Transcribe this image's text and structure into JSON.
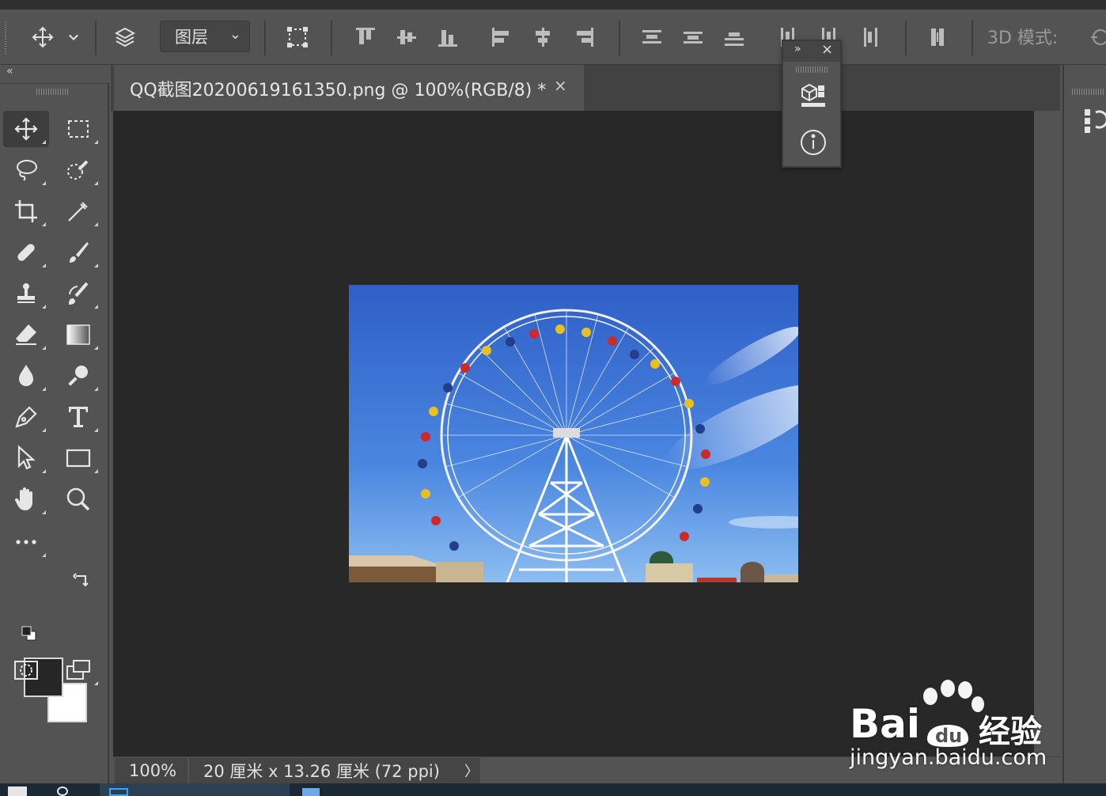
{
  "options_bar": {
    "layer_select_value": "图层",
    "mode_3d_label": "3D 模式:"
  },
  "document": {
    "tab_title": "QQ截图20200619161350.png @ 100%(RGB/8) *",
    "tab_close": "×"
  },
  "status_bar": {
    "zoom": "100%",
    "doc_size": "20 厘米 x 13.26 厘米 (72 ppi)",
    "arrow": "〉"
  },
  "mini_panel": {
    "expand_label": "»",
    "close_label": "×"
  },
  "toolbar": {
    "collapse_label": "«",
    "tools": [
      "move-tool",
      "rectangular-marquee-tool",
      "lasso-tool",
      "quick-selection-tool",
      "crop-tool",
      "eyedropper-tool",
      "spot-healing-tool",
      "brush-tool",
      "clone-stamp-tool",
      "history-brush-tool",
      "eraser-tool",
      "gradient-tool",
      "blur-tool",
      "dodge-tool",
      "pen-tool",
      "type-tool",
      "path-selection-tool",
      "rectangle-tool",
      "hand-tool",
      "zoom-tool",
      "edit-toolbar"
    ],
    "foreground_color": "#262626",
    "background_color": "#ffffff"
  },
  "watermark": {
    "brand": "Bai",
    "brand_suffix": "经验",
    "url": "jingyan.baidu.com"
  }
}
